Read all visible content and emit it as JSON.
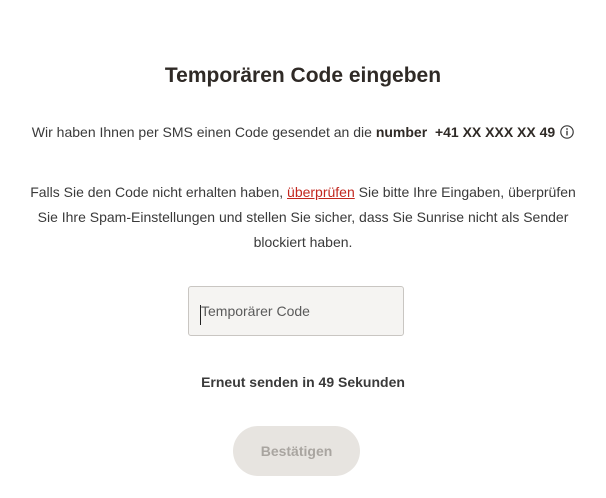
{
  "title": "Temporären Code eingeben",
  "sms_message": {
    "prefix": "Wir haben Ihnen per SMS einen Code gesendet an die ",
    "number_label": "number",
    "number_value": "+41 XX XXX XX 49",
    "info_icon": "info-circle-icon"
  },
  "help": {
    "before_link": "Falls Sie den Code nicht erhalten haben, ",
    "link_text": "überprüfen",
    "after_link": " Sie bitte Ihre Eingaben, überprüfen Sie Ihre Spam-Einstellungen und stellen Sie sicher, dass Sie Sunrise nicht als Sender blockiert haben.",
    "link_color": "#c2271f"
  },
  "code_input": {
    "placeholder": "Temporärer Code",
    "value": ""
  },
  "resend_text": "Erneut senden in 49 Sekunden",
  "confirm_button": {
    "label": "Bestätigen",
    "state": "disabled"
  }
}
